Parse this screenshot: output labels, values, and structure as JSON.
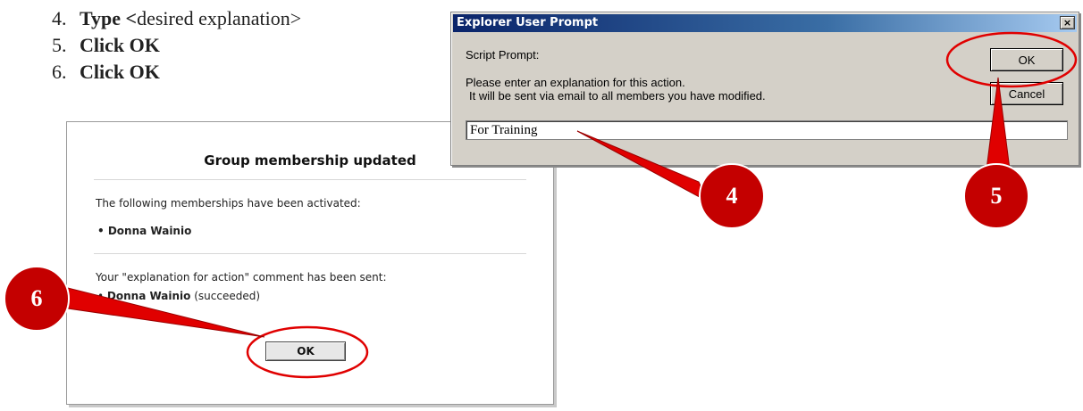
{
  "steps": [
    {
      "num": "4.",
      "action": "Type <",
      "detail": "desired explanation>"
    },
    {
      "num": "5.",
      "action": "Click OK"
    },
    {
      "num": "6.",
      "action": "Click OK"
    }
  ],
  "web_panel": {
    "title": "Group membership updated",
    "activated_text": "The following memberships have been activated:",
    "activated_member": "• Donna Wainio",
    "comment_text": "Your \"explanation for action\" comment has been sent:",
    "sent_member_prefix": "• ",
    "sent_member_name": "Donna Wainio",
    "sent_member_status": " (succeeded)",
    "ok_label": "OK"
  },
  "dialog": {
    "title": "Explorer User Prompt",
    "close_label": "×",
    "script_prompt_label": "Script Prompt:",
    "message_line1": "Please enter an explanation for this action.",
    "message_line2": "It will be sent via email to all members you have modified.",
    "ok_label": "OK",
    "cancel_label": "Cancel",
    "input_value": "For Training"
  },
  "annotations": {
    "badge_4": "4",
    "badge_5": "5",
    "badge_6": "6",
    "color_red": "#e00000",
    "color_dark_red": "#b30000"
  },
  "colors": {
    "titlebar_start": "#0a246a",
    "titlebar_end": "#a6caf0",
    "dialog_face": "#d4d0c8"
  }
}
